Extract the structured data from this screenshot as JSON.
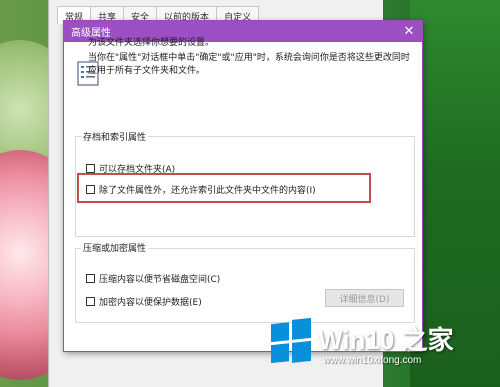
{
  "background_window": {
    "tabs": [
      "常规",
      "共享",
      "安全",
      "以前的版本",
      "自定义"
    ],
    "active_tab": 0
  },
  "dialog": {
    "title": "高级属性",
    "close_glyph": "✕",
    "intro_line1": "为该文件夹选择你想要的设置。",
    "intro_line2": "当你在\"属性\"对话框中单击\"确定\"或\"应用\"时，系统会询问你是否将这些更改同时应用于所有子文件夹和文件。",
    "archive_group": {
      "title": "存档和索引属性",
      "options": [
        {
          "label": "可以存档文件夹(A)",
          "checked": false
        },
        {
          "label": "除了文件属性外，还允许索引此文件夹中文件的内容(I)",
          "checked": false,
          "highlighted": true
        }
      ]
    },
    "compress_group": {
      "title": "压缩或加密属性",
      "options": [
        {
          "label": "压缩内容以便节省磁盘空间(C)",
          "checked": false
        },
        {
          "label": "加密内容以便保护数据(E)",
          "checked": false
        }
      ],
      "details_button": "详细信息(D)"
    }
  },
  "watermark": {
    "brand_a": "Win10",
    "brand_b": " 之家",
    "url": "www.win10xitong.com"
  },
  "colors": {
    "title_bar": "#9b4fc2",
    "highlight_box": "#c0504d",
    "watermark_logo": "#0a8fdc"
  },
  "icons": {
    "dialog_icon": "document-list-icon",
    "close": "close-icon",
    "logo": "windows-logo-icon"
  }
}
